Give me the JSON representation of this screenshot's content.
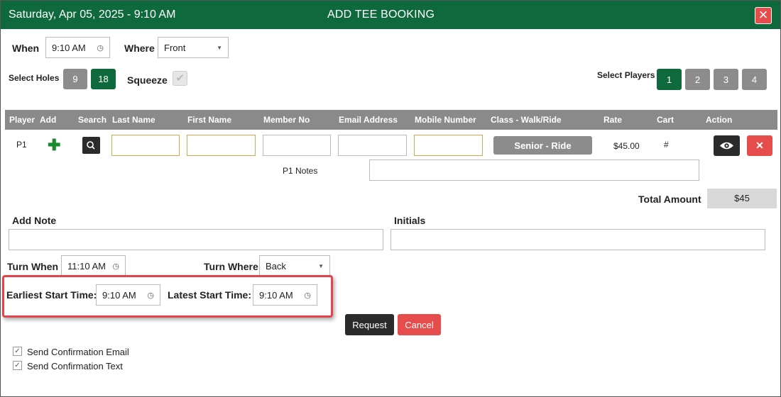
{
  "header": {
    "datetime": "Saturday, Apr 05, 2025 - 9:10 AM",
    "title": "ADD TEE BOOKING",
    "close_label": "×"
  },
  "when": {
    "label": "When",
    "value": "9:10 AM"
  },
  "where": {
    "label": "Where",
    "value": "Front"
  },
  "holes": {
    "label": "Select Holes",
    "options": [
      "9",
      "18"
    ],
    "selected": "18"
  },
  "squeeze": {
    "label": "Squeeze",
    "checked": true
  },
  "players": {
    "label": "Select Players",
    "options": [
      "1",
      "2",
      "3",
      "4"
    ],
    "selected": "1"
  },
  "table": {
    "headers": [
      "Player",
      "Add",
      "Search",
      "Last Name",
      "First Name",
      "Member No",
      "Email Address",
      "Mobile Number",
      "Class - Walk/Ride",
      "Rate",
      "Cart",
      "Action"
    ],
    "row": {
      "player": "P1",
      "class_button": "Senior - Ride",
      "rate": "$45.00",
      "cart": "#",
      "notes_label": "P1 Notes"
    }
  },
  "total": {
    "label": "Total Amount",
    "value": "$45"
  },
  "add_note": {
    "label": "Add Note",
    "value": ""
  },
  "initials": {
    "label": "Initials",
    "value": ""
  },
  "turn_when": {
    "label": "Turn When",
    "value": "11:10 AM"
  },
  "turn_where": {
    "label": "Turn Where",
    "value": "Back"
  },
  "earliest": {
    "label": "Earliest Start Time:",
    "value": "9:10 AM"
  },
  "latest": {
    "label": "Latest Start Time:",
    "value": "9:10 AM"
  },
  "buttons": {
    "request": "Request",
    "cancel": "Cancel"
  },
  "confirm_email": {
    "label": "Send Confirmation Email",
    "checked": true
  },
  "confirm_text": {
    "label": "Send Confirmation Text",
    "checked": true
  },
  "colors": {
    "brand_green": "#0e6a3c",
    "danger_red": "#e74c4c",
    "highlight_red": "#e5434b"
  },
  "icons": [
    "close-icon",
    "clock-icon",
    "plus-icon",
    "search-icon",
    "eye-icon",
    "delete-icon",
    "check-icon",
    "caret-down-icon"
  ]
}
